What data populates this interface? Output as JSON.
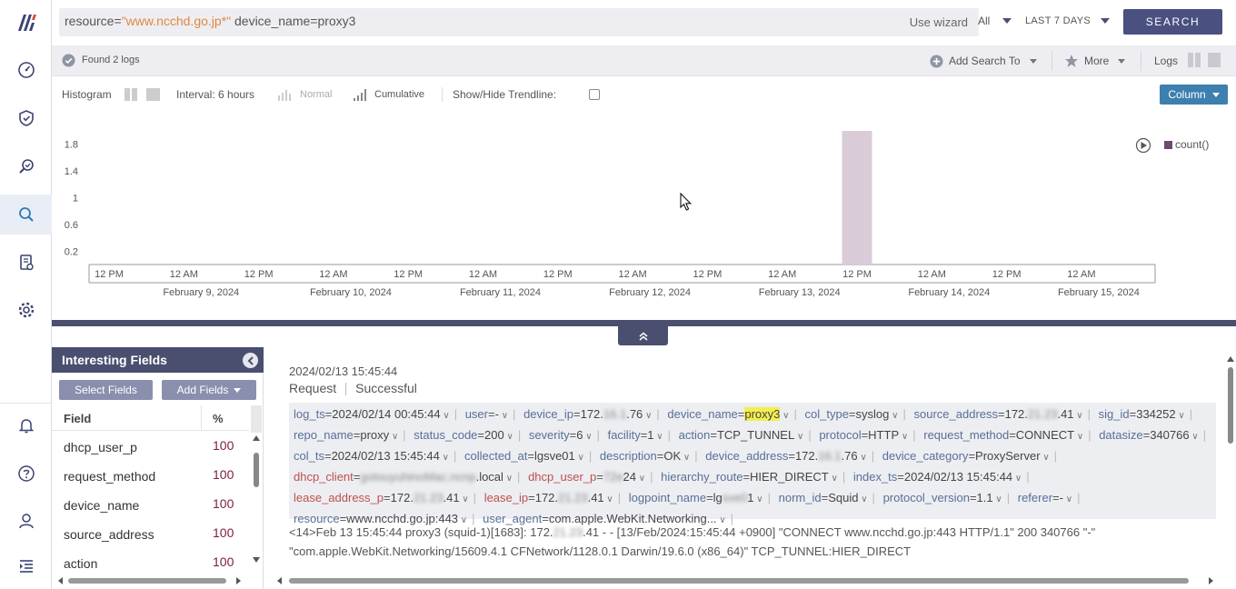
{
  "query": {
    "key1": "resource=",
    "val1": "\"www.ncchd.go.jp*\"",
    "rest": " device_name=proxy3",
    "wizard": "Use wizard"
  },
  "topbar": {
    "scope": "All",
    "range": "LAST 7 DAYS",
    "search": "SEARCH"
  },
  "status": {
    "found": "Found 2 logs",
    "add_search": "Add Search To",
    "more": "More",
    "logs": "Logs"
  },
  "histo": {
    "label": "Histogram",
    "interval": "Interval: 6 hours",
    "normal": "Normal",
    "cumulative": "Cumulative",
    "trendline": "Show/Hide Trendline:",
    "column": "Column"
  },
  "chart_data": {
    "type": "bar",
    "legend": [
      "count()"
    ],
    "y_ticks": [
      "1.8",
      "1.4",
      "1",
      "0.6",
      "0.2"
    ],
    "x_ticks": [
      "12 PM",
      "12 AM",
      "12 PM",
      "12 AM",
      "12 PM",
      "12 AM",
      "12 PM",
      "12 AM",
      "12 PM",
      "12 AM",
      "12 PM",
      "12 AM",
      "12 PM",
      "12 AM"
    ],
    "date_labels": [
      "February 9, 2024",
      "February 10, 2024",
      "February 11, 2024",
      "February 12, 2024",
      "February 13, 2024",
      "February 14, 2024",
      "February 15, 2024"
    ],
    "ylim": [
      0,
      2
    ],
    "bars": [
      {
        "x": "2024-02-13 12:00",
        "value": 2
      }
    ],
    "color": "#d9cbd8"
  },
  "fields": {
    "title": "Interesting Fields",
    "select": "Select Fields",
    "add": "Add Fields",
    "col_field": "Field",
    "col_pct": "%",
    "rows": [
      {
        "name": "dhcp_user_p",
        "pct": "100"
      },
      {
        "name": "request_method",
        "pct": "100"
      },
      {
        "name": "device_name",
        "pct": "100"
      },
      {
        "name": "source_address",
        "pct": "100"
      },
      {
        "name": "action",
        "pct": "100"
      }
    ]
  },
  "log": {
    "ts": "2024/02/13 15:45:44",
    "tag1": "Request",
    "tag2": "Successful",
    "kv": [
      {
        "k": "log_ts",
        "v": "2024/02/14 00:45:44"
      },
      {
        "k": "user",
        "v": "-"
      },
      {
        "k": "device_ip",
        "v": "172.",
        "blur": "16.1",
        "v2": ".76"
      },
      {
        "k": "device_name",
        "v": "proxy3",
        "hl": true
      },
      {
        "k": "col_type",
        "v": "syslog"
      },
      {
        "k": "source_address",
        "v": "172.",
        "blur": "21.23",
        "v2": ".41"
      },
      {
        "k": "sig_id",
        "v": "334252"
      },
      {
        "k": "repo_name",
        "v": "proxy"
      },
      {
        "k": "status_code",
        "v": "200"
      },
      {
        "k": "severity",
        "v": "6"
      },
      {
        "k": "facility",
        "v": "1"
      },
      {
        "k": "action",
        "v": "TCP_TUNNEL"
      },
      {
        "k": "protocol",
        "v": "HTTP"
      },
      {
        "k": "request_method",
        "v": "CONNECT"
      },
      {
        "k": "datasize",
        "v": "340766"
      },
      {
        "k": "col_ts",
        "v": "2024/02/13 15:45:44"
      },
      {
        "k": "collected_at",
        "v": "lgsve01"
      },
      {
        "k": "description",
        "v": "OK"
      },
      {
        "k": "device_address",
        "v": "172.",
        "blur": "16.1",
        "v2": ".76"
      },
      {
        "k": "device_category",
        "v": "ProxyServer"
      },
      {
        "k": "dhcp_client",
        "v": "",
        "blur": "gotouyuhinoMac.ncnp",
        "v2": ".local",
        "red": true
      },
      {
        "k": "dhcp_user_p",
        "v": "",
        "blur": "72e",
        "v2": "24",
        "red": true
      },
      {
        "k": "hierarchy_route",
        "v": "HIER_DIRECT"
      },
      {
        "k": "index_ts",
        "v": "2024/02/13 15:45:44"
      },
      {
        "k": "lease_address_p",
        "v": "172.",
        "blur": "21.23",
        "v2": ".41",
        "red": true
      },
      {
        "k": "lease_ip",
        "v": "172.",
        "blur": "21.23",
        "v2": ".41",
        "red": true
      },
      {
        "k": "logpoint_name",
        "v": "lg",
        "blur": "sve0",
        "v2": "1"
      },
      {
        "k": "norm_id",
        "v": "Squid"
      },
      {
        "k": "protocol_version",
        "v": "1.1"
      },
      {
        "k": "referer",
        "v": "-"
      },
      {
        "k": "resource",
        "v": "www.ncchd.go.jp:443"
      },
      {
        "k": "user_agent",
        "v": "com.apple.WebKit.Networking..."
      }
    ],
    "raw1": "<14>Feb 13 15:45:44 proxy3 (squid-1)[1683]: 172.",
    "raw_blur": "21.23",
    "raw2": ".41 - - [13/Feb/2024:15:45:44 +0900] \"CONNECT www.ncchd.go.jp:443 HTTP/1.1\" 200 340766 \"-\" \"com.apple.WebKit.Networking/15609.4.1 CFNetwork/1128.0.1 Darwin/19.6.0 (x86_64)\" TCP_TUNNEL:HIER_DIRECT"
  }
}
